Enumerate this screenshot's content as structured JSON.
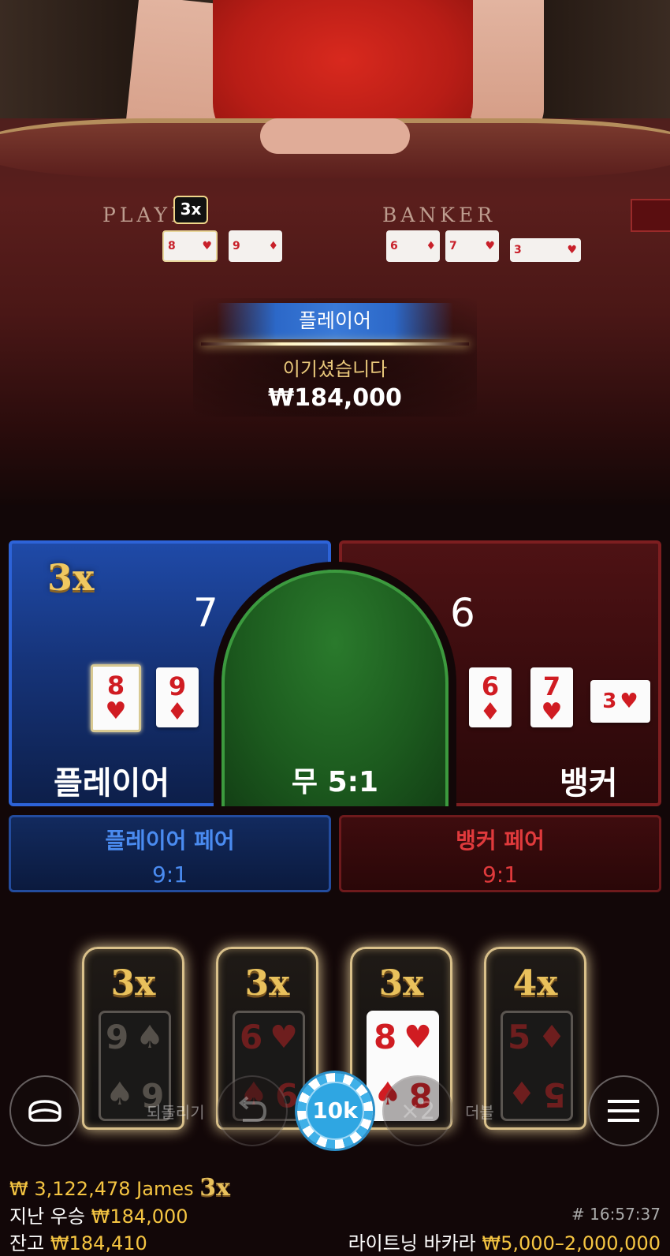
{
  "video": {
    "table_labels": {
      "player": "PLAYER",
      "banker": "BANKER"
    },
    "table_multiplier": "3x",
    "table_cards": {
      "player": [
        {
          "rank": "8",
          "suit": "♥"
        },
        {
          "rank": "9",
          "suit": "♦"
        }
      ],
      "banker": [
        {
          "rank": "6",
          "suit": "♦"
        },
        {
          "rank": "7",
          "suit": "♥"
        },
        {
          "rank": "3",
          "suit": "♥"
        }
      ]
    }
  },
  "result": {
    "winner": "플레이어",
    "message": "이기셨습니다",
    "amount": "₩184,000"
  },
  "betting": {
    "player": {
      "label": "플레이어",
      "multiplier": "3x",
      "score": "7",
      "cards": [
        {
          "rank": "8",
          "suit": "♥"
        },
        {
          "rank": "9",
          "suit": "♦"
        }
      ]
    },
    "tie": {
      "label": "무 5:1"
    },
    "banker": {
      "label": "뱅커",
      "score": "6",
      "cards": [
        {
          "rank": "6",
          "suit": "♦"
        },
        {
          "rank": "7",
          "suit": "♥"
        },
        {
          "rank": "3",
          "suit": "♥"
        }
      ]
    },
    "player_pair": {
      "label": "플레이어 페어",
      "odds": "9:1"
    },
    "banker_pair": {
      "label": "뱅커 페어",
      "odds": "9:1"
    }
  },
  "lightning_cards": [
    {
      "multiplier": "3x",
      "rank": "9",
      "suit": "♠",
      "rank_bottom": "6",
      "suit_bottom": "♠"
    },
    {
      "multiplier": "3x",
      "rank": "6",
      "suit": "♥",
      "rank_bottom": "9",
      "suit_bottom": "♠"
    },
    {
      "multiplier": "3x",
      "rank": "8",
      "suit": "♥",
      "rank_bottom": "8",
      "suit_bottom": "♠"
    },
    {
      "multiplier": "4x",
      "rank": "5",
      "suit": "♦",
      "rank_bottom": "5",
      "suit_bottom": "♦"
    }
  ],
  "controls": {
    "undo_label": "되돌리기",
    "double_label": "더블",
    "double_symbol": "×2",
    "chip_value": "10k"
  },
  "footer": {
    "bet_amount": "₩ 3,122,478",
    "player_name": "James",
    "bet_multiplier": "3x",
    "last_win_label": "지난 우승",
    "last_win_value": "₩184,000",
    "balance_label": "잔고",
    "balance_value": "₩184,410",
    "time": "# 16:57:37",
    "game_name": "라이트닝 바카라",
    "limits": "₩5,000–2,000,000"
  },
  "colors": {
    "player_blue": "#2d63d8",
    "banker_red": "#7d1e20",
    "tie_green": "#3c9a3e",
    "gold": "#f5c542",
    "suit_red": "#d01c22"
  },
  "icons": [
    "chat-icon",
    "undo-icon",
    "double-icon",
    "menu-icon",
    "chip-icon"
  ]
}
